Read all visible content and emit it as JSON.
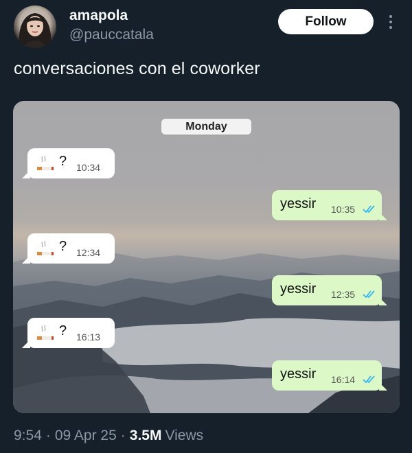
{
  "user": {
    "name": "amapola",
    "handle": "@pauccatala",
    "follow_label": "Follow"
  },
  "tweet": {
    "text": "conversaciones con el coworker"
  },
  "chat": {
    "day_label": "Monday",
    "incoming": [
      {
        "emoji": "🚬",
        "text": "?",
        "time": "10:34"
      },
      {
        "emoji": "🚬",
        "text": "?",
        "time": "12:34"
      },
      {
        "emoji": "🚬",
        "text": "?",
        "time": "16:13"
      }
    ],
    "outgoing": [
      {
        "text": "yessir",
        "time": "10:35",
        "status": "read"
      },
      {
        "text": "yessir",
        "time": "12:35",
        "status": "read"
      },
      {
        "text": "yessir",
        "time": "16:14",
        "status": "read"
      }
    ],
    "colors": {
      "incoming_bubble": "#ffffff",
      "outgoing_bubble": "#dcf8c6",
      "read_ticks": "#34b7f1"
    }
  },
  "meta": {
    "time": "9:54",
    "date": "09 Apr 25",
    "views_count": "3.5M",
    "views_label": "Views"
  },
  "icons": {
    "more": "more-vertical-icon",
    "cigarette": "cigarette-icon",
    "ticks": "double-check-icon"
  },
  "theme": {
    "background": "#15202b",
    "text": "#f7f9f9",
    "muted": "#8b98a5"
  }
}
